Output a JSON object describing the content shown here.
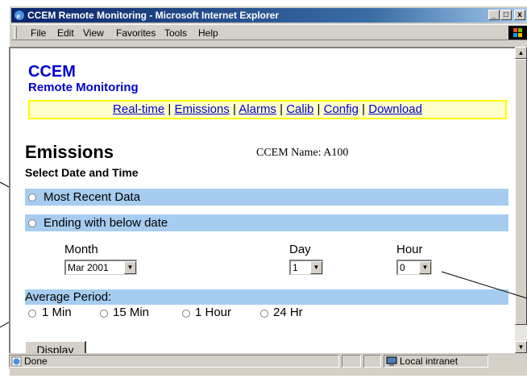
{
  "window": {
    "title": "CCEM Remote Monitoring - Microsoft Internet Explorer",
    "buttons": {
      "minimize": "_",
      "maximize": "□",
      "close": "x"
    }
  },
  "menubar": {
    "items": [
      "File",
      "Edit",
      "View",
      "Favorites",
      "Tools",
      "Help"
    ]
  },
  "page": {
    "brand_line1": "CCEM",
    "brand_line2": "Remote Monitoring",
    "nav": {
      "links": [
        "Real-time",
        "Emissions",
        "Alarms",
        "Calib",
        "Config",
        "Download"
      ],
      "separator": "|"
    },
    "heading": "Emissions",
    "ccem_name": "CCEM Name: A100",
    "subheading": "Select Date and Time",
    "options": {
      "most_recent": "Most Recent Data",
      "ending_with": "Ending with below date"
    },
    "month": {
      "label": "Month",
      "value": "Mar 2001"
    },
    "day": {
      "label": "Day",
      "value": "1"
    },
    "hour": {
      "label": "Hour",
      "value": "0"
    },
    "average_period": {
      "label": "Average Period:",
      "options": [
        "1 Min",
        "15 Min",
        "1 Hour",
        "24 Hr"
      ]
    },
    "display_button": "Display"
  },
  "statusbar": {
    "status": "Done",
    "zone": "Local intranet"
  },
  "colors": {
    "title_bar": "#0a246a",
    "link": "#0000cc",
    "band": "#a6cdf0",
    "nav_background": "#ffffcc",
    "nav_border": "#ffff00"
  },
  "icons": {
    "title": "ie-icon",
    "status": "ie-page-icon",
    "zone": "intranet-icon"
  }
}
